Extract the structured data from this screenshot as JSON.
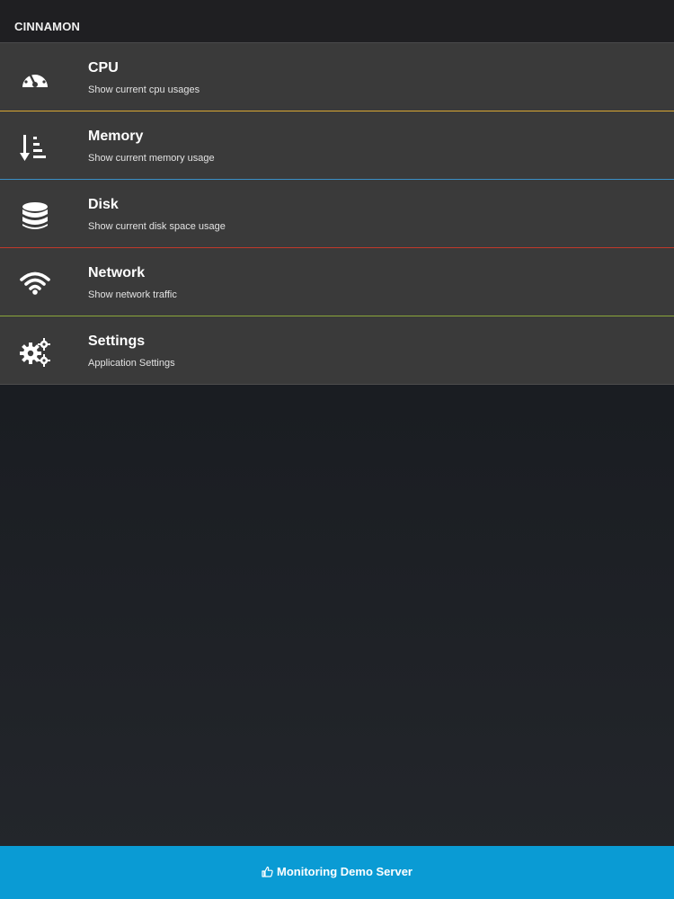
{
  "header": {
    "title": "CINNAMON"
  },
  "menu": {
    "items": [
      {
        "title": "CPU",
        "subtitle": "Show current cpu usages",
        "icon": "dashboard-gauge-icon",
        "accent": "#d9a733"
      },
      {
        "title": "Memory",
        "subtitle": "Show current memory usage",
        "icon": "sort-amount-icon",
        "accent": "#3a8fc6"
      },
      {
        "title": "Disk",
        "subtitle": "Show current disk space usage",
        "icon": "database-icon",
        "accent": "#c0392b"
      },
      {
        "title": "Network",
        "subtitle": "Show network traffic",
        "icon": "wifi-icon",
        "accent": "#8aa63a"
      },
      {
        "title": "Settings",
        "subtitle": "Application Settings",
        "icon": "gears-icon",
        "accent": "#4d4d4d"
      }
    ]
  },
  "footer": {
    "label": "Monitoring Demo Server",
    "icon": "thumbs-up-icon",
    "color": "#0a9bd4"
  }
}
